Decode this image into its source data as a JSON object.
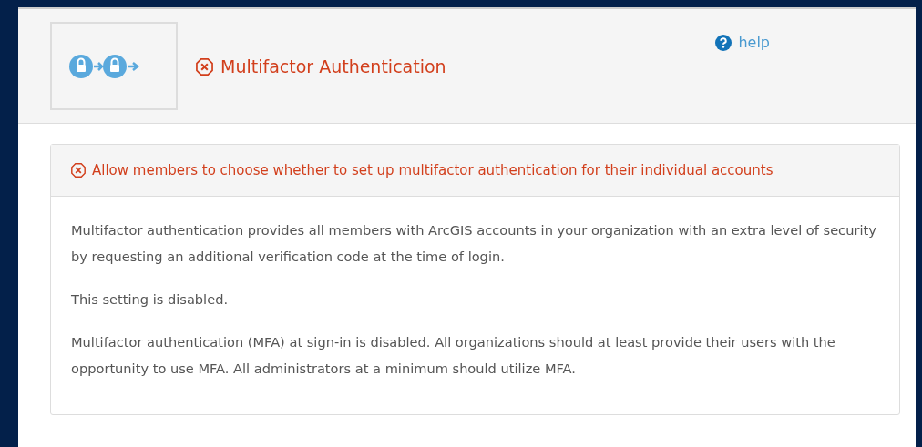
{
  "header": {
    "title": "Multifactor Authentication",
    "passed": false,
    "help": "help"
  },
  "setting": {
    "title": "Allow members to choose whether to set up multifactor authentication for their individual accounts",
    "passed": false,
    "paragraphs": [
      "Multifactor authentication provides all members with ArcGIS accounts in your organization with an extra level of security by requesting an additional verification code at the time of login.",
      "This setting is disabled.",
      "Multifactor authentication (MFA) at sign-in is disabled. All organizations should at least provide their users with the opportunity to use MFA. All administrators at a minimum should utilize MFA."
    ]
  }
}
